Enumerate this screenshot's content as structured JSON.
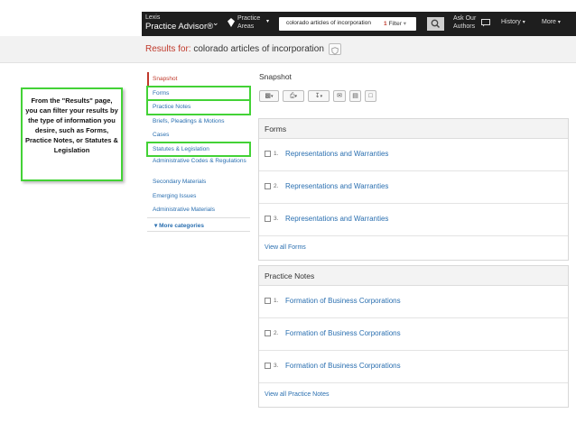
{
  "topbar": {
    "brand_small": "Lexis",
    "brand_big": "Practice Advisor®",
    "practice_areas_line1": "Practice",
    "practice_areas_line2": "Areas",
    "search_query": "colorado articles of incorporation",
    "filter_count": "1",
    "filter_label": "Filter",
    "ask_line1": "Ask Our",
    "ask_line2": "Authors",
    "history_label": "History",
    "more_label": "More"
  },
  "results": {
    "label": "Results for: ",
    "query": "colorado articles of incorporation"
  },
  "callout": {
    "text": "From the \"Results\" page, you can filter your results by the type of information you desire, such as Forms, Practice Notes, or Statutes & Legislation"
  },
  "sidebar": {
    "items": [
      {
        "label": "Snapshot"
      },
      {
        "label": "Forms"
      },
      {
        "label": "Practice Notes"
      },
      {
        "label": "Briefs, Pleadings & Motions"
      },
      {
        "label": "Cases"
      },
      {
        "label": "Statutes & Legislation"
      },
      {
        "label": "Administrative Codes & Regulations"
      },
      {
        "label": "Secondary Materials"
      },
      {
        "label": "Emerging Issues"
      },
      {
        "label": "Administrative Materials"
      }
    ],
    "more": "More categories"
  },
  "main": {
    "title": "Snapshot",
    "forms": {
      "heading": "Forms",
      "rows": [
        {
          "num": "1.",
          "label": "Representations and Warranties"
        },
        {
          "num": "2.",
          "label": "Representations and Warranties"
        },
        {
          "num": "3.",
          "label": "Representations and Warranties"
        }
      ],
      "view_all": "View all Forms"
    },
    "practice_notes": {
      "heading": "Practice Notes",
      "rows": [
        {
          "num": "1.",
          "label": "Formation of Business Corporations"
        },
        {
          "num": "2.",
          "label": "Formation of Business Corporations"
        },
        {
          "num": "3.",
          "label": "Formation of Business Corporations"
        }
      ],
      "view_all": "View all Practice Notes"
    }
  },
  "colors": {
    "accent_red": "#c0392b",
    "link_blue": "#2a6fb0",
    "highlight_green": "#43d236",
    "nav_dark": "#1e1e1e"
  }
}
